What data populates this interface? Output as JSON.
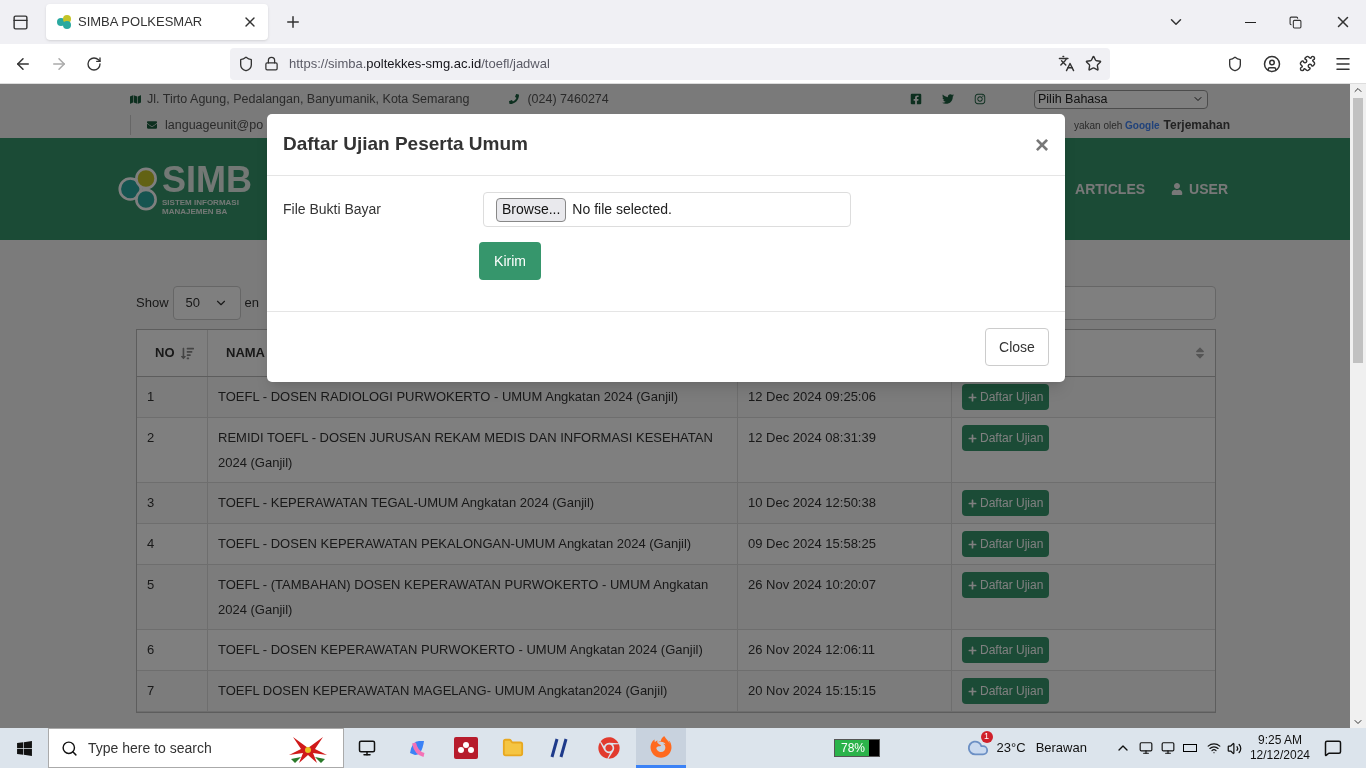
{
  "browser": {
    "tab": {
      "title": "SIMBA POLKESMAR",
      "selected": true
    },
    "url": {
      "scheme": "https://simba.",
      "domain": "poltekkes-smg.ac.id",
      "path": "/toefl/jadwal"
    }
  },
  "topbar": {
    "address": "Jl. Tirto Agung, Pedalangan, Banyumanik, Kota Semarang",
    "phone": "(024) 7460274",
    "email": "languageunit@po",
    "language_select": "Pilih Bahasa",
    "translate_credit": "yakan oleh",
    "translate_brand": "Google",
    "translate_link": "Terjemahan"
  },
  "header": {
    "logo_text": "SIMB",
    "logo_subtitle": "SISTEM INFORMASI MANAJEMEN BA",
    "nav": [
      "ARTICLES",
      "USER"
    ]
  },
  "table_controls": {
    "show_label": "Show",
    "page_size": "50",
    "entries_label": "en"
  },
  "table": {
    "columns": [
      "NO",
      "NAMA"
    ],
    "rows": [
      {
        "no": "1",
        "name": "TOEFL - DOSEN RADIOLOGI PURWOKERTO - UMUM Angkatan 2024 (Ganjil)",
        "date": "12 Dec 2024 09:25:06",
        "action": "Daftar Ujian"
      },
      {
        "no": "2",
        "name": "REMIDI TOEFL - DOSEN JURUSAN REKAM MEDIS DAN INFORMASI KESEHATAN 2024 (Ganjil)",
        "date": "12 Dec 2024 08:31:39",
        "action": "Daftar Ujian"
      },
      {
        "no": "3",
        "name": "TOEFL - KEPERAWATAN TEGAL-UMUM Angkatan 2024 (Ganjil)",
        "date": "10 Dec 2024 12:50:38",
        "action": "Daftar Ujian"
      },
      {
        "no": "4",
        "name": "TOEFL - DOSEN KEPERAWATAN PEKALONGAN-UMUM Angkatan 2024 (Ganjil)",
        "date": "09 Dec 2024 15:58:25",
        "action": "Daftar Ujian"
      },
      {
        "no": "5",
        "name": "TOEFL - (TAMBAHAN) DOSEN KEPERAWATAN PURWOKERTO - UMUM Angkatan 2024 (Ganjil)",
        "date": "26 Nov 2024 10:20:07",
        "action": "Daftar Ujian"
      },
      {
        "no": "6",
        "name": "TOEFL - DOSEN KEPERAWATAN PURWOKERTO - UMUM Angkatan 2024 (Ganjil)",
        "date": "26 Nov 2024 12:06:11",
        "action": "Daftar Ujian"
      },
      {
        "no": "7",
        "name": "TOEFL DOSEN KEPERAWATAN MAGELANG- UMUM Angkatan2024 (Ganjil)",
        "date": "20 Nov 2024 15:15:15",
        "action": "Daftar Ujian"
      }
    ]
  },
  "modal": {
    "title": "Daftar Ujian Peserta Umum",
    "close_symbol": "×",
    "field_label": "File Bukti Bayar",
    "browse_button": "Browse...",
    "file_status": "No file selected.",
    "submit": "Kirim",
    "footer_button": "Close"
  },
  "taskbar": {
    "search_placeholder": "Type here to search",
    "battery": {
      "reading": "78%",
      "level": 0.78
    },
    "notification_badge": "1",
    "temperature": "23°C",
    "weather": "Berawan",
    "time": "9:25 AM",
    "date": "12/12/2024"
  }
}
